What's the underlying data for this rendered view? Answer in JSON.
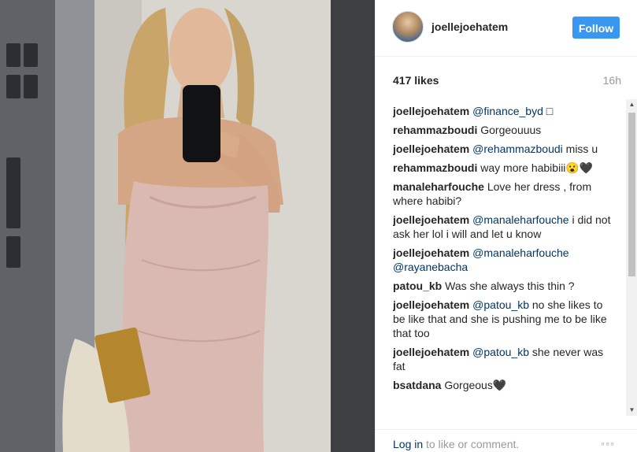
{
  "post": {
    "username": "joellejoehatem",
    "follow_label": "Follow",
    "likes": "417 likes",
    "time_ago": "16h"
  },
  "comments": [
    {
      "user": "joellejoehatem",
      "mention": "@finance_byd",
      "text": " □"
    },
    {
      "user": "rehammazboudi",
      "mention": "",
      "text": "Gorgeouuus"
    },
    {
      "user": "joellejoehatem",
      "mention": "@rehammazboudi",
      "text": " miss u"
    },
    {
      "user": "rehammazboudi",
      "mention": "",
      "text": "way more habibiii😮🖤"
    },
    {
      "user": "manaleharfouche",
      "mention": "",
      "text": "Love her dress , from where habibi?"
    },
    {
      "user": "joellejoehatem",
      "mention": "@manaleharfouche",
      "text": " i did not ask her lol i will and let u know"
    },
    {
      "user": "joellejoehatem",
      "mention": "@manaleharfouche @rayanebacha",
      "text": ""
    },
    {
      "user": "patou_kb",
      "mention": "",
      "text": "Was she always this thin ?"
    },
    {
      "user": "joellejoehatem",
      "mention": "@patou_kb",
      "text": " no she likes to be like that and she is pushing me to be like that too"
    },
    {
      "user": "joellejoehatem",
      "mention": "@patou_kb",
      "text": " she never was fat"
    },
    {
      "user": "bsatdana",
      "mention": "",
      "text": "Gorgeous🖤"
    }
  ],
  "footer": {
    "login_label": "Log in",
    "rest_text": " to like or comment.",
    "more_icon": "◦◦◦"
  },
  "scroll": {
    "up_icon": "▲",
    "down_icon": "▼"
  },
  "colors": {
    "accent": "#3897f0",
    "link": "#003569",
    "muted": "#999999",
    "dress": "#d9b9b2"
  }
}
